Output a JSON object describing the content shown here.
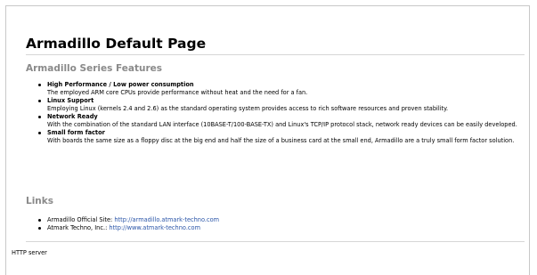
{
  "page": {
    "title": "Armadillo Default Page",
    "features_heading": "Armadillo Series Features",
    "features": [
      {
        "title": "High Performance / Low power consumption",
        "desc": "The employed ARM core CPUs provide performance without heat and the need for a fan."
      },
      {
        "title": "Linux Support",
        "desc": "Employing Linux (kernels 2.4 and 2.6) as the standard operating system provides access to rich software resources and proven stability."
      },
      {
        "title": "Network Ready",
        "desc": "With the combination of the standard LAN interface (10BASE-T/100-BASE-TX) and Linux's TCP/IP protocol stack, network ready devices can be easily developed."
      },
      {
        "title": "Small form factor",
        "desc": "With boards the same size as a floppy disc at the big end and half the size of a business card at the small end, Armadillo are a truly small form factor solution."
      }
    ],
    "links_heading": "Links",
    "links": [
      {
        "label": "Armadillo Official Site: ",
        "url_text": "http://armadillo.atmark-techno.com"
      },
      {
        "label": "Atmark Techno, Inc.: ",
        "url_text": "http://www.atmark-techno.com"
      }
    ],
    "footer": "HTTP server"
  },
  "colors": {
    "heading_gray": "#8a8a8a",
    "link_blue": "#2a55a8",
    "rule": "#d6d6d6"
  }
}
